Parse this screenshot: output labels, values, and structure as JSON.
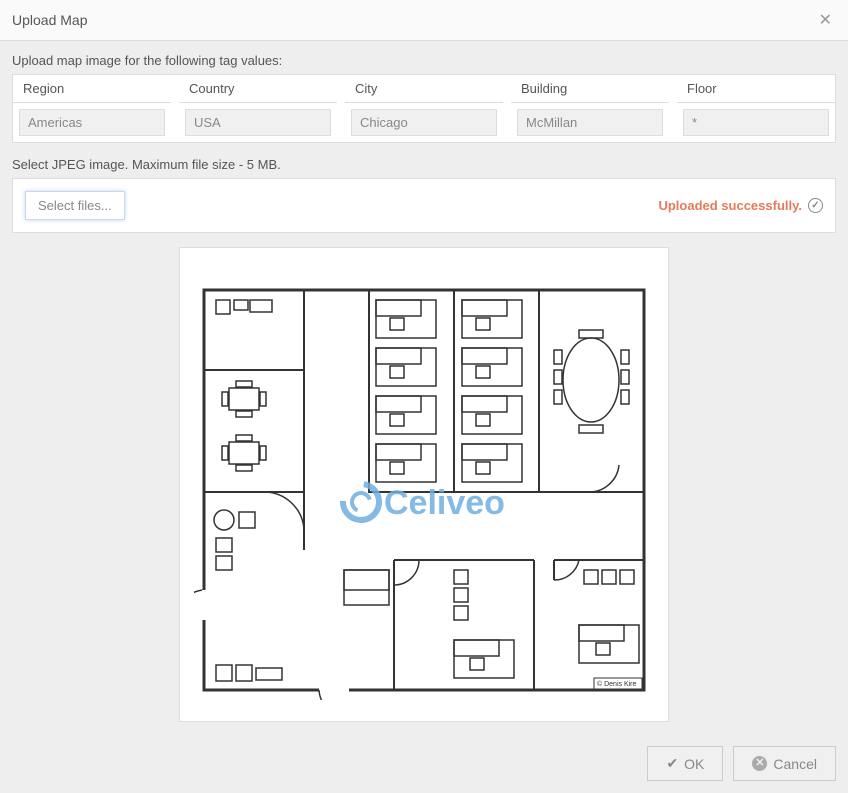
{
  "dialog": {
    "title": "Upload Map"
  },
  "instructions": {
    "tag_label": "Upload map image for the following tag values:",
    "file_label": "Select JPEG image. Maximum file size - 5 MB."
  },
  "tags": {
    "headers": {
      "region": "Region",
      "country": "Country",
      "city": "City",
      "building": "Building",
      "floor": "Floor"
    },
    "values": {
      "region": "Americas",
      "country": "USA",
      "city": "Chicago",
      "building": "McMillan",
      "floor": "*"
    }
  },
  "upload": {
    "select_button": "Select files...",
    "status": "Uploaded successfully."
  },
  "preview": {
    "watermark": "Celiveo",
    "copyright": "© Denis Kire"
  },
  "footer": {
    "ok": "OK",
    "cancel": "Cancel"
  }
}
